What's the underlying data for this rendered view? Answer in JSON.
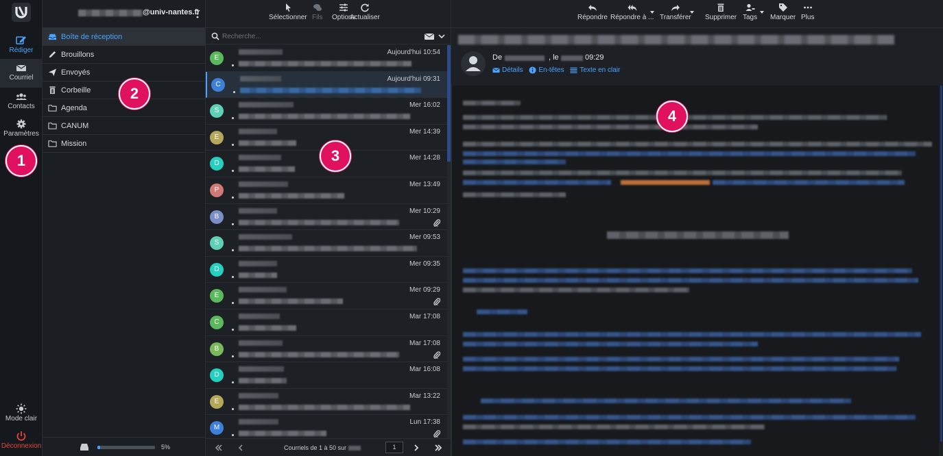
{
  "account": {
    "domain": "@univ-nantes.fr"
  },
  "rail": {
    "compose": "Rédiger",
    "mail": "Courriel",
    "contacts": "Contacts",
    "settings": "Paramètres",
    "theme": "Mode clair",
    "logout": "Déconnexion"
  },
  "folders": [
    {
      "label": "Boîte de réception",
      "icon": "inbox-icon"
    },
    {
      "label": "Brouillons",
      "icon": "pencil-icon"
    },
    {
      "label": "Envoyés",
      "icon": "paper-plane-icon"
    },
    {
      "label": "Corbeille",
      "icon": "trash-icon"
    },
    {
      "label": "Agenda",
      "icon": "folder-icon"
    },
    {
      "label": "CANUM",
      "icon": "folder-icon"
    },
    {
      "label": "Mission",
      "icon": "folder-icon"
    }
  ],
  "quota": {
    "percent": 5,
    "label": "5%"
  },
  "list_toolbar": {
    "select": "Sélectionner",
    "threads": "Fils",
    "options": "Options",
    "refresh": "Actualiser"
  },
  "search": {
    "placeholder": "Recherche..."
  },
  "messages": [
    {
      "initial": "E",
      "color": "#5cb85c",
      "date": "Aujourd'hui 10:54",
      "attachment": false
    },
    {
      "initial": "C",
      "color": "#3d7fd9",
      "date": "Aujourd'hui 09:31",
      "attachment": false
    },
    {
      "initial": "S",
      "color": "#5fd0b6",
      "date": "Mer 16:02",
      "attachment": false
    },
    {
      "initial": "E",
      "color": "#b5a85a",
      "date": "Mer 14:39",
      "attachment": false
    },
    {
      "initial": "D",
      "color": "#26d0c0",
      "date": "Mer 14:28",
      "attachment": false
    },
    {
      "initial": "P",
      "color": "#d07a78",
      "date": "Mer 13:49",
      "attachment": false
    },
    {
      "initial": "B",
      "color": "#7a8fc8",
      "date": "Mer 10:29",
      "attachment": true
    },
    {
      "initial": "S",
      "color": "#5fd0b6",
      "date": "Mer 09:53",
      "attachment": false
    },
    {
      "initial": "D",
      "color": "#26d0c0",
      "date": "Mer 09:35",
      "attachment": false
    },
    {
      "initial": "E",
      "color": "#5cb85c",
      "date": "Mer 09:29",
      "attachment": true
    },
    {
      "initial": "C",
      "color": "#5cb85c",
      "date": "Mar 17:08",
      "attachment": false
    },
    {
      "initial": "B",
      "color": "#7ab85c",
      "date": "Mar 17:08",
      "attachment": true
    },
    {
      "initial": "D",
      "color": "#26d0c0",
      "date": "Mar 16:08",
      "attachment": false
    },
    {
      "initial": "E",
      "color": "#b5a85a",
      "date": "Mar 13:22",
      "attachment": false
    },
    {
      "initial": "M",
      "color": "#3d7fd9",
      "date": "Lun 17:38",
      "attachment": true
    }
  ],
  "pager": {
    "label": "Courriels de 1 à 50 sur",
    "page": "1"
  },
  "reader_toolbar": {
    "reply": "Répondre",
    "reply_all": "Répondre à ...",
    "forward": "Transférer",
    "delete": "Supprimer",
    "tags": "Tags",
    "mark": "Marquer",
    "more": "Plus"
  },
  "reader": {
    "from_prefix": "De",
    "date_prefix": ", le",
    "time": "09:29",
    "details": "Détails",
    "headers": "En-têtes",
    "plaintext": "Texte en clair"
  },
  "callouts": [
    "1",
    "2",
    "3",
    "4"
  ]
}
